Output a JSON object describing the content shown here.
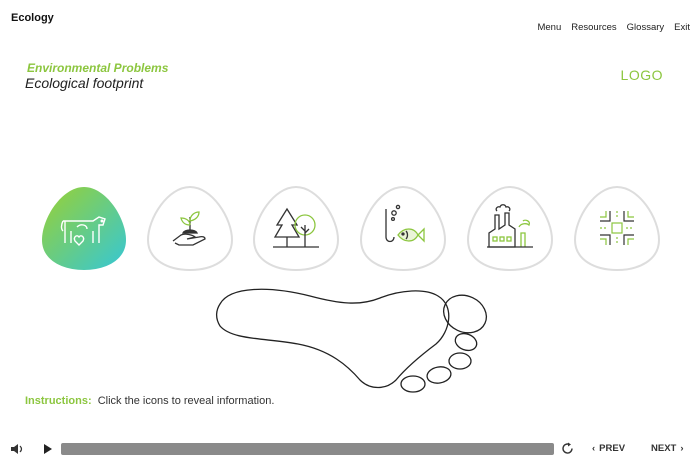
{
  "app": {
    "title": "Ecology"
  },
  "nav": {
    "menu": "Menu",
    "resources": "Resources",
    "glossary": "Glossary",
    "exit": "Exit"
  },
  "header": {
    "subtitle": "Environmental Problems",
    "title": "Ecological footprint",
    "logo": "LOGO"
  },
  "colors": {
    "accent": "#8cc63f",
    "accent_gradient_end": "#35c7d6",
    "icon_border": "#dddddd"
  },
  "icons": [
    {
      "name": "livestock-icon",
      "active": true
    },
    {
      "name": "plant-in-hand-icon",
      "active": false
    },
    {
      "name": "forest-icon",
      "active": false
    },
    {
      "name": "fishing-icon",
      "active": false
    },
    {
      "name": "factory-icon",
      "active": false
    },
    {
      "name": "road-intersection-icon",
      "active": false
    }
  ],
  "instructions": {
    "label": "Instructions:",
    "text": "Click the icons to reveal information."
  },
  "player": {
    "volume_icon": "speaker-icon",
    "play_icon": "play-icon",
    "replay_icon": "replay-icon",
    "prev_label": "PREV",
    "next_label": "NEXT"
  }
}
